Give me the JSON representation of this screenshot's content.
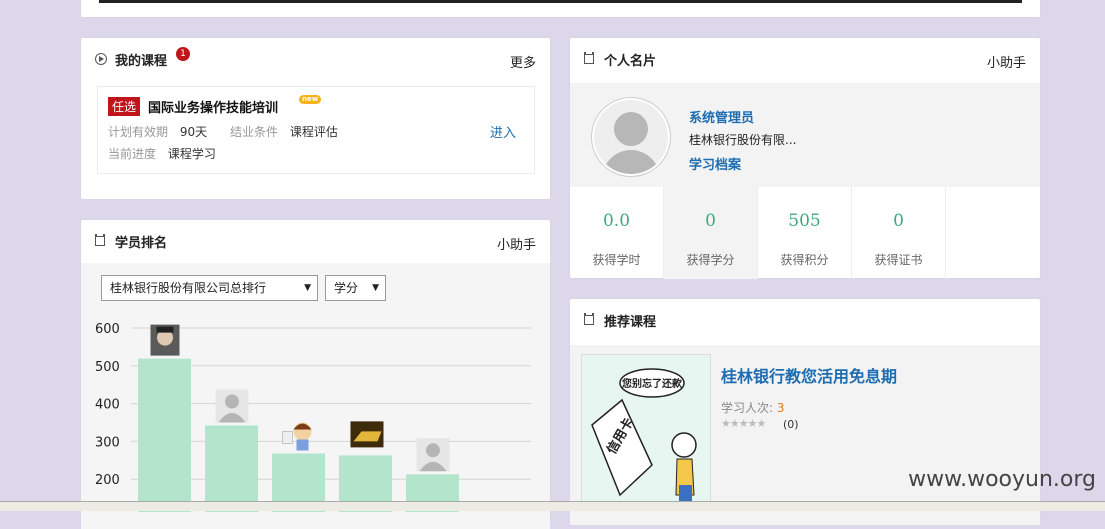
{
  "my_course": {
    "title": "我的课程",
    "badge": "1",
    "more": "更多",
    "course": {
      "tag": "任选",
      "name": "国际业务操作技能培训",
      "new_label": "new",
      "validity_label": "计划有效期",
      "validity_value": "90天",
      "completion_label": "结业条件",
      "completion_value": "课程评估",
      "progress_label": "当前进度",
      "progress_value": "课程学习",
      "enter": "进入"
    }
  },
  "ranking": {
    "title": "学员排名",
    "helper": "小助手",
    "scope_select": "桂林银行股份有限公司总排行",
    "metric_select": "学分"
  },
  "profile": {
    "title": "个人名片",
    "helper": "小助手",
    "name": "系统管理员",
    "org": "桂林银行股份有限...",
    "archive_link": "学习档案",
    "stats": [
      {
        "value": "0.0",
        "label": "获得学时"
      },
      {
        "value": "0",
        "label": "获得学分"
      },
      {
        "value": "505",
        "label": "获得积分"
      },
      {
        "value": "0",
        "label": "获得证书"
      }
    ]
  },
  "recommend": {
    "title": "推荐课程",
    "course_title": "桂林银行教您活用免息期",
    "learners_label": "学习人次:",
    "learners_count": "3",
    "rating": "(0)",
    "image_text": "您别忘了还款",
    "image_card_text": "信用卡"
  },
  "watermark": "www.wooyun.org",
  "colors": {
    "bar": "#b3e5cc",
    "link": "#1d6db0",
    "accent_red": "#c0151b",
    "stat_green": "#3cab7a"
  },
  "chart_data": {
    "type": "bar",
    "categories": [
      "",
      "",
      "",
      "",
      ""
    ],
    "values": [
      519,
      342,
      268,
      263,
      213
    ],
    "yticks": [
      200,
      300,
      400,
      500,
      600
    ],
    "ylim": [
      100,
      640
    ],
    "avatars": [
      "photo",
      "default",
      "cartoon",
      "gold",
      "default"
    ],
    "grid": true
  }
}
